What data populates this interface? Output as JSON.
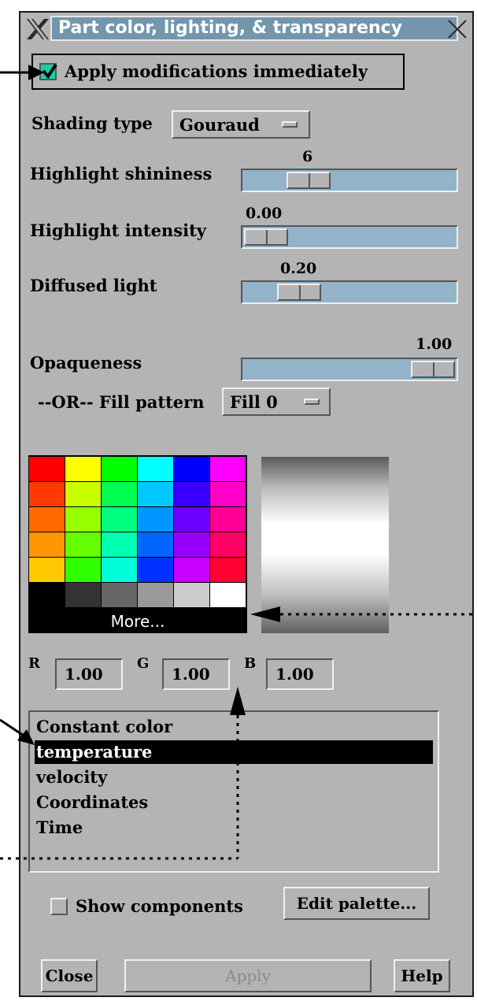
{
  "window": {
    "title": "Part color, lighting, & transparency"
  },
  "apply_immediately": {
    "label": "Apply modifications immediately",
    "checked": true
  },
  "shading": {
    "label": "Shading type",
    "value": "Gouraud"
  },
  "sliders": [
    {
      "label": "Highlight shininess",
      "value": "6",
      "fraction": 0.15
    },
    {
      "label": "Highlight intensity",
      "value": "0.00",
      "fraction": 0.0
    },
    {
      "label": "Diffused light",
      "value": "0.20",
      "fraction": 0.2
    },
    {
      "label": "Opaqueness",
      "value": "1.00",
      "fraction": 1.0
    }
  ],
  "fill": {
    "label": "--OR-- Fill pattern",
    "value": "Fill 0"
  },
  "palette": {
    "more_label": "More...",
    "rows": [
      [
        "#ff0000",
        "#ffff00",
        "#00ff00",
        "#00ffff",
        "#0000ff",
        "#ff00ff"
      ],
      [
        "#ff3a00",
        "#c8ff00",
        "#00ff50",
        "#00c8ff",
        "#3a00ff",
        "#ff00c8"
      ],
      [
        "#ff6a00",
        "#96ff00",
        "#00ff80",
        "#0096ff",
        "#6a00ff",
        "#ff0096"
      ],
      [
        "#ff9600",
        "#64ff00",
        "#00ffb0",
        "#0064ff",
        "#9600ff",
        "#ff0064"
      ],
      [
        "#ffc800",
        "#30ff00",
        "#00ffd8",
        "#0030ff",
        "#c800ff",
        "#ff0030"
      ],
      [
        "#000000",
        "#333333",
        "#666666",
        "#999999",
        "#cccccc",
        "#ffffff"
      ]
    ]
  },
  "rgb": {
    "r_label": "R",
    "r_value": "1.00",
    "g_label": "G",
    "g_value": "1.00",
    "b_label": "B",
    "b_value": "1.00"
  },
  "variables": {
    "items": [
      "Constant color",
      "temperature",
      "velocity",
      "Coordinates",
      "Time"
    ],
    "selected_index": 1
  },
  "show_components": {
    "label": "Show components",
    "checked": false
  },
  "buttons": {
    "edit_palette": "Edit palette...",
    "close": "Close",
    "apply": "Apply",
    "help": "Help"
  }
}
